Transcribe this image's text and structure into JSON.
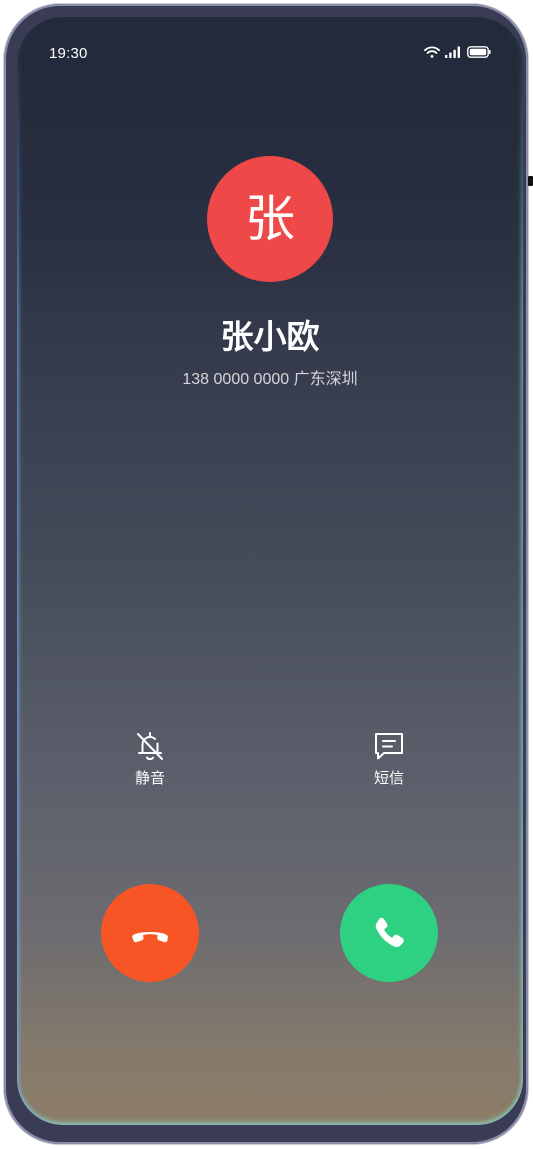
{
  "status_bar": {
    "time": "19:30",
    "icons": [
      "wifi-icon",
      "signal-icon",
      "battery-icon"
    ]
  },
  "caller": {
    "avatar_text": "张",
    "avatar_color": "#ef4848",
    "name": "张小欧",
    "info": "138 0000 0000 广东深圳"
  },
  "actions": {
    "mute": {
      "label": "静音",
      "icon": "bell-off-icon"
    },
    "message": {
      "label": "短信",
      "icon": "message-icon"
    }
  },
  "buttons": {
    "decline": {
      "icon": "phone-hangup-icon",
      "color": "#f85527"
    },
    "answer": {
      "icon": "phone-icon",
      "color": "#2ed082"
    }
  }
}
